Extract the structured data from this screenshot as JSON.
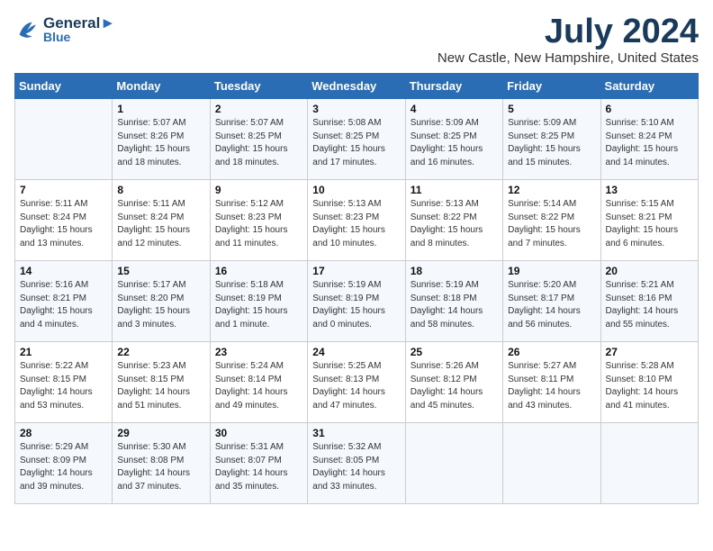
{
  "header": {
    "logo_line1": "General",
    "logo_line2": "Blue",
    "month_title": "July 2024",
    "location": "New Castle, New Hampshire, United States"
  },
  "weekdays": [
    "Sunday",
    "Monday",
    "Tuesday",
    "Wednesday",
    "Thursday",
    "Friday",
    "Saturday"
  ],
  "weeks": [
    [
      {
        "day": "",
        "info": ""
      },
      {
        "day": "1",
        "info": "Sunrise: 5:07 AM\nSunset: 8:26 PM\nDaylight: 15 hours\nand 18 minutes."
      },
      {
        "day": "2",
        "info": "Sunrise: 5:07 AM\nSunset: 8:25 PM\nDaylight: 15 hours\nand 18 minutes."
      },
      {
        "day": "3",
        "info": "Sunrise: 5:08 AM\nSunset: 8:25 PM\nDaylight: 15 hours\nand 17 minutes."
      },
      {
        "day": "4",
        "info": "Sunrise: 5:09 AM\nSunset: 8:25 PM\nDaylight: 15 hours\nand 16 minutes."
      },
      {
        "day": "5",
        "info": "Sunrise: 5:09 AM\nSunset: 8:25 PM\nDaylight: 15 hours\nand 15 minutes."
      },
      {
        "day": "6",
        "info": "Sunrise: 5:10 AM\nSunset: 8:24 PM\nDaylight: 15 hours\nand 14 minutes."
      }
    ],
    [
      {
        "day": "7",
        "info": "Sunrise: 5:11 AM\nSunset: 8:24 PM\nDaylight: 15 hours\nand 13 minutes."
      },
      {
        "day": "8",
        "info": "Sunrise: 5:11 AM\nSunset: 8:24 PM\nDaylight: 15 hours\nand 12 minutes."
      },
      {
        "day": "9",
        "info": "Sunrise: 5:12 AM\nSunset: 8:23 PM\nDaylight: 15 hours\nand 11 minutes."
      },
      {
        "day": "10",
        "info": "Sunrise: 5:13 AM\nSunset: 8:23 PM\nDaylight: 15 hours\nand 10 minutes."
      },
      {
        "day": "11",
        "info": "Sunrise: 5:13 AM\nSunset: 8:22 PM\nDaylight: 15 hours\nand 8 minutes."
      },
      {
        "day": "12",
        "info": "Sunrise: 5:14 AM\nSunset: 8:22 PM\nDaylight: 15 hours\nand 7 minutes."
      },
      {
        "day": "13",
        "info": "Sunrise: 5:15 AM\nSunset: 8:21 PM\nDaylight: 15 hours\nand 6 minutes."
      }
    ],
    [
      {
        "day": "14",
        "info": "Sunrise: 5:16 AM\nSunset: 8:21 PM\nDaylight: 15 hours\nand 4 minutes."
      },
      {
        "day": "15",
        "info": "Sunrise: 5:17 AM\nSunset: 8:20 PM\nDaylight: 15 hours\nand 3 minutes."
      },
      {
        "day": "16",
        "info": "Sunrise: 5:18 AM\nSunset: 8:19 PM\nDaylight: 15 hours\nand 1 minute."
      },
      {
        "day": "17",
        "info": "Sunrise: 5:19 AM\nSunset: 8:19 PM\nDaylight: 15 hours\nand 0 minutes."
      },
      {
        "day": "18",
        "info": "Sunrise: 5:19 AM\nSunset: 8:18 PM\nDaylight: 14 hours\nand 58 minutes."
      },
      {
        "day": "19",
        "info": "Sunrise: 5:20 AM\nSunset: 8:17 PM\nDaylight: 14 hours\nand 56 minutes."
      },
      {
        "day": "20",
        "info": "Sunrise: 5:21 AM\nSunset: 8:16 PM\nDaylight: 14 hours\nand 55 minutes."
      }
    ],
    [
      {
        "day": "21",
        "info": "Sunrise: 5:22 AM\nSunset: 8:15 PM\nDaylight: 14 hours\nand 53 minutes."
      },
      {
        "day": "22",
        "info": "Sunrise: 5:23 AM\nSunset: 8:15 PM\nDaylight: 14 hours\nand 51 minutes."
      },
      {
        "day": "23",
        "info": "Sunrise: 5:24 AM\nSunset: 8:14 PM\nDaylight: 14 hours\nand 49 minutes."
      },
      {
        "day": "24",
        "info": "Sunrise: 5:25 AM\nSunset: 8:13 PM\nDaylight: 14 hours\nand 47 minutes."
      },
      {
        "day": "25",
        "info": "Sunrise: 5:26 AM\nSunset: 8:12 PM\nDaylight: 14 hours\nand 45 minutes."
      },
      {
        "day": "26",
        "info": "Sunrise: 5:27 AM\nSunset: 8:11 PM\nDaylight: 14 hours\nand 43 minutes."
      },
      {
        "day": "27",
        "info": "Sunrise: 5:28 AM\nSunset: 8:10 PM\nDaylight: 14 hours\nand 41 minutes."
      }
    ],
    [
      {
        "day": "28",
        "info": "Sunrise: 5:29 AM\nSunset: 8:09 PM\nDaylight: 14 hours\nand 39 minutes."
      },
      {
        "day": "29",
        "info": "Sunrise: 5:30 AM\nSunset: 8:08 PM\nDaylight: 14 hours\nand 37 minutes."
      },
      {
        "day": "30",
        "info": "Sunrise: 5:31 AM\nSunset: 8:07 PM\nDaylight: 14 hours\nand 35 minutes."
      },
      {
        "day": "31",
        "info": "Sunrise: 5:32 AM\nSunset: 8:05 PM\nDaylight: 14 hours\nand 33 minutes."
      },
      {
        "day": "",
        "info": ""
      },
      {
        "day": "",
        "info": ""
      },
      {
        "day": "",
        "info": ""
      }
    ]
  ]
}
